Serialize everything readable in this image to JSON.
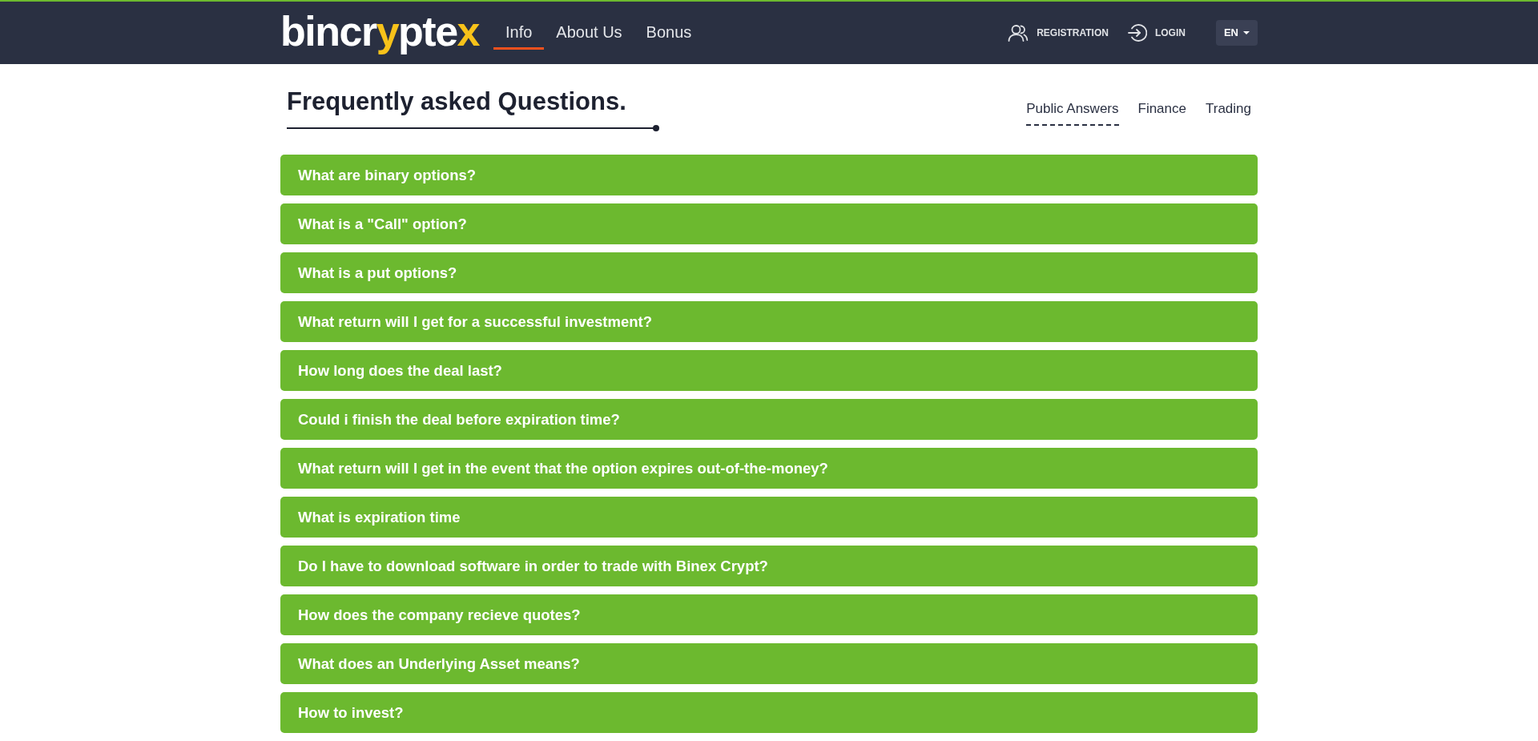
{
  "header": {
    "logo": {
      "parts": [
        {
          "text": "bincr",
          "accent": false
        },
        {
          "text": "y",
          "accent": true
        },
        {
          "text": "pte",
          "accent": false
        },
        {
          "text": "x",
          "accent": true
        }
      ]
    },
    "nav": [
      {
        "label": "Info",
        "selected": true
      },
      {
        "label": "About Us",
        "selected": false
      },
      {
        "label": "Bonus",
        "selected": false
      }
    ],
    "actions": [
      {
        "kind": "registration",
        "label": "REGISTRATION"
      },
      {
        "kind": "login",
        "label": "LOGIN"
      }
    ],
    "language": {
      "label": "EN"
    }
  },
  "faq": {
    "title": "Frequently asked Questions.",
    "tabs": [
      {
        "label": "Public Answers",
        "selected": true
      },
      {
        "label": "Finance",
        "selected": false
      },
      {
        "label": "Trading",
        "selected": false
      }
    ],
    "questions": [
      "What are binary options?",
      "What is a \"Call\" option?",
      "What is a put options?",
      "What return will I get for a successful investment?",
      "How long does the deal last?",
      "Could i finish the deal before expiration time?",
      "What return will I get in the event that the option expires out-of-the-money?",
      "What is expiration time",
      "Do I have to download software in order to trade with Binex Crypt?",
      "How does the company recieve quotes?",
      "What does an Underlying Asset means?",
      "How to invest?"
    ]
  }
}
